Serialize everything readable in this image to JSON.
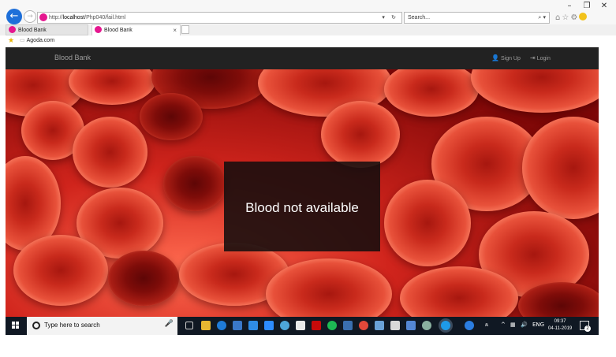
{
  "browser": {
    "address_scheme": "http://",
    "address_host": "localhost",
    "address_path": "/Php040/fail.html",
    "search_placeholder": "Search...",
    "tabs": [
      {
        "label": "Blood Bank"
      },
      {
        "label": "Blood Bank",
        "close": "×"
      }
    ],
    "favorites": [
      {
        "label": "Agoda.com"
      }
    ]
  },
  "site": {
    "brand": "Blood Bank",
    "nav": {
      "signup_label": "Sign Up",
      "login_label": "Login"
    },
    "message": "Blood not available"
  },
  "taskbar": {
    "search_placeholder": "Type here to search",
    "language": "ENG",
    "time": "09:37",
    "date": "04-11-2019",
    "notifications": "2"
  },
  "colors": {
    "navbar": "#222222",
    "accent_blue": "#1e6fd9",
    "favicon": "#e5178f",
    "message_box": "#140e0e",
    "taskbar": "#101823"
  }
}
